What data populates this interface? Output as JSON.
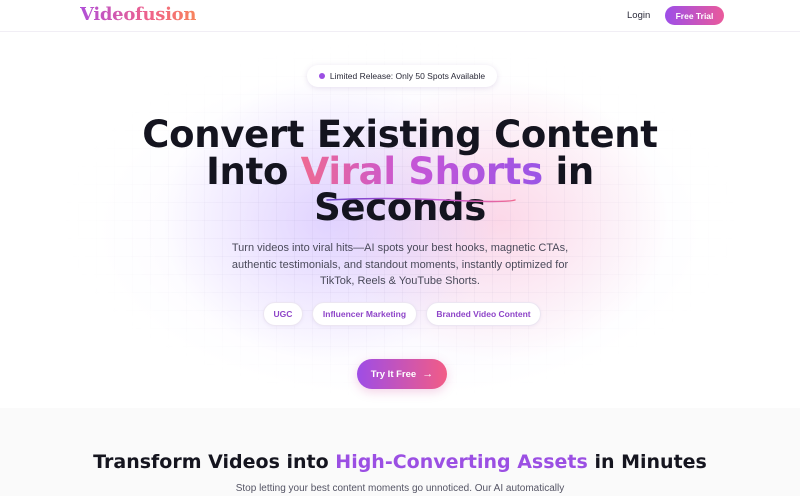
{
  "header": {
    "logo": "Videofusion",
    "login_label": "Login",
    "trial_label": "Free Trial"
  },
  "hero": {
    "badge_text": "Limited Release: Only 50 Spots Available",
    "headline_line1": "Convert Existing Content",
    "headline_into": "Into",
    "headline_highlight": "Viral Shorts",
    "headline_in": "in",
    "headline_line3": "Seconds",
    "subtext": "Turn videos into viral hits—AI spots your best hooks, magnetic CTAs, authentic testimonials, and standout moments, instantly optimized for TikTok, Reels & YouTube Shorts.",
    "chips": [
      "UGC",
      "Influencer Marketing",
      "Branded Video Content"
    ],
    "cta_label": "Try It Free"
  },
  "features": {
    "title_prefix": "Transform Videos into",
    "title_highlight": "High-Converting Assets",
    "title_suffix": "in Minutes",
    "subtitle": "Stop letting your best content moments go unnoticed. Our AI automatically"
  },
  "colors": {
    "brand_purple": "#9b4fe3",
    "brand_pink": "#f25c86"
  },
  "icons": {
    "cta_arrow": "arrow-right-icon",
    "badge_dot": "status-dot-icon"
  }
}
